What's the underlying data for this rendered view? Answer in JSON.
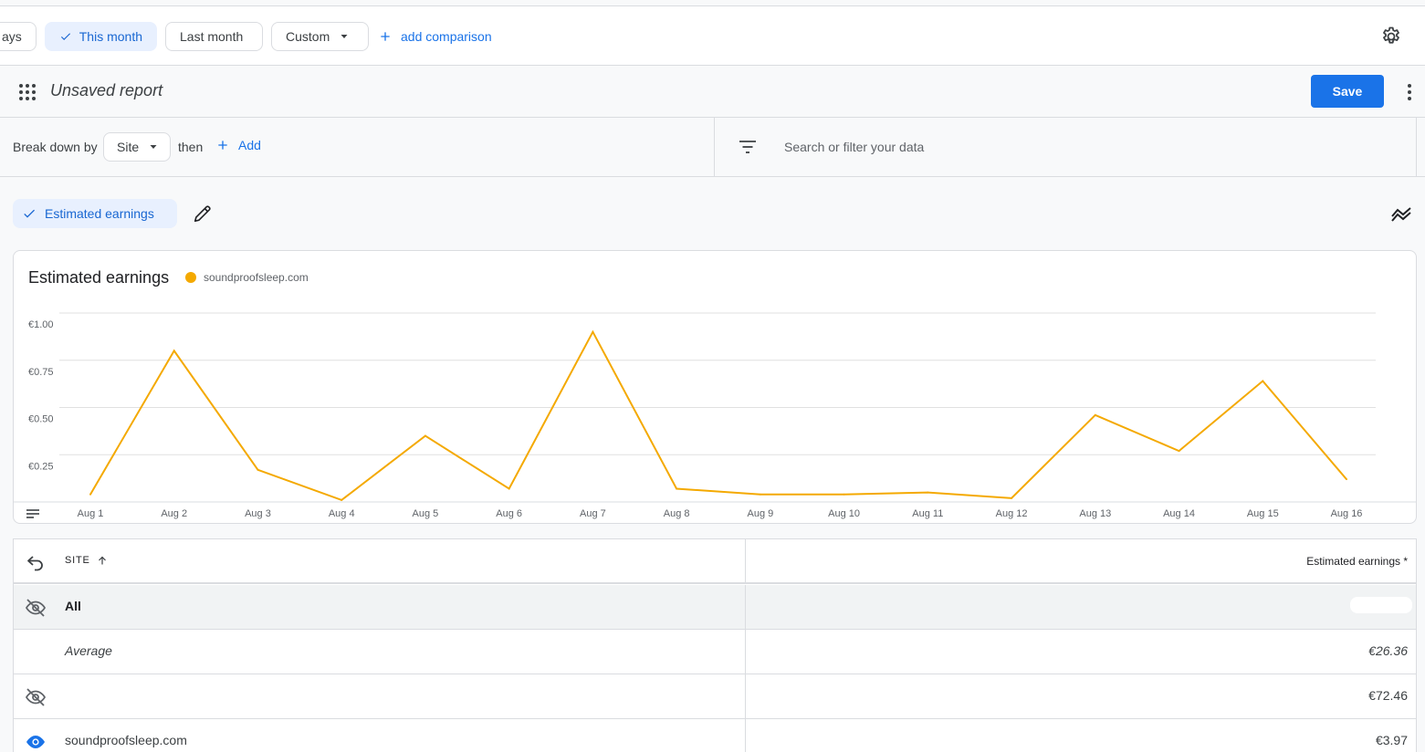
{
  "date_range": {
    "chips": [
      {
        "label": "ays",
        "selected": false
      },
      {
        "label": "This month",
        "selected": true
      },
      {
        "label": "Last month",
        "selected": false
      },
      {
        "label": "Custom",
        "selected": false
      }
    ],
    "add_comparison": "add comparison"
  },
  "report": {
    "title": "Unsaved report",
    "save_label": "Save"
  },
  "breakdown": {
    "label": "Break down by",
    "dimension": "Site",
    "then": "then",
    "add": "Add",
    "search_placeholder": "Search or filter your data"
  },
  "metric_chip": {
    "label": "Estimated earnings"
  },
  "chart": {
    "card_title": "Estimated earnings",
    "legend": "soundproofsleep.com",
    "series_color": "#f4a900"
  },
  "chart_data": {
    "type": "line",
    "title": "Estimated earnings",
    "x": [
      "Aug 1",
      "Aug 2",
      "Aug 3",
      "Aug 4",
      "Aug 5",
      "Aug 6",
      "Aug 7",
      "Aug 8",
      "Aug 9",
      "Aug 10",
      "Aug 11",
      "Aug 12",
      "Aug 13",
      "Aug 14",
      "Aug 15",
      "Aug 16"
    ],
    "series": [
      {
        "name": "soundproofsleep.com",
        "values": [
          0.04,
          0.8,
          0.17,
          0.01,
          0.35,
          0.07,
          0.9,
          0.07,
          0.04,
          0.04,
          0.05,
          0.02,
          0.46,
          0.27,
          0.64,
          0.12
        ]
      }
    ],
    "yticks": [
      {
        "value": 0.25,
        "label": "€0.25"
      },
      {
        "value": 0.5,
        "label": "€0.50"
      },
      {
        "value": 0.75,
        "label": "€0.75"
      },
      {
        "value": 1.0,
        "label": "€1.00"
      }
    ],
    "ylim": [
      0,
      1.0
    ],
    "grid": true,
    "legend_position": "top-left"
  },
  "table": {
    "header": {
      "site": "SITE",
      "metric": "Estimated earnings *"
    },
    "rows": [
      {
        "label": "All",
        "value": ""
      },
      {
        "label": "Average",
        "value": "€26.36"
      },
      {
        "label": "",
        "value": "€72.46"
      },
      {
        "label": "soundproofsleep.com",
        "value": "€3.97"
      }
    ]
  },
  "colors": {
    "accent": "#1a73e8",
    "chip_selected_bg": "#e8f0fe",
    "series": "#f4a900"
  }
}
